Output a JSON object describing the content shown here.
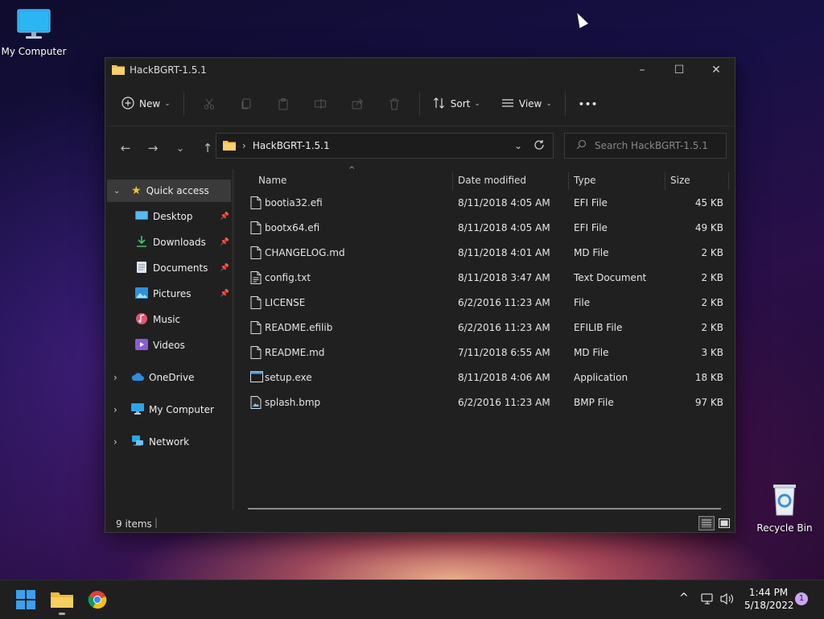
{
  "desktop": {
    "my_computer_label": "My Computer",
    "recycle_bin_label": "Recycle Bin"
  },
  "window": {
    "title": "HackBGRT-1.5.1",
    "controls": {
      "minimize": "–",
      "maximize": "☐",
      "close": "✕"
    }
  },
  "toolbar": {
    "new_label": "New",
    "sort_label": "Sort",
    "view_label": "View",
    "more_label": "•••"
  },
  "address": {
    "path": "HackBGRT-1.5.1",
    "search_placeholder": "Search HackBGRT-1.5.1"
  },
  "sidebar": {
    "quick_access": "Quick access",
    "items": [
      {
        "label": "Desktop",
        "pinned": true
      },
      {
        "label": "Downloads",
        "pinned": true
      },
      {
        "label": "Documents",
        "pinned": true
      },
      {
        "label": "Pictures",
        "pinned": true
      },
      {
        "label": "Music",
        "pinned": false
      },
      {
        "label": "Videos",
        "pinned": false
      }
    ],
    "onedrive": "OneDrive",
    "my_computer": "My Computer",
    "network": "Network"
  },
  "columns": {
    "name": "Name",
    "date": "Date modified",
    "type": "Type",
    "size": "Size"
  },
  "files": [
    {
      "name": "bootia32.efi",
      "date": "8/11/2018 4:05 AM",
      "type": "EFI File",
      "size": "45 KB",
      "icon": "file-icon"
    },
    {
      "name": "bootx64.efi",
      "date": "8/11/2018 4:05 AM",
      "type": "EFI File",
      "size": "49 KB",
      "icon": "file-icon"
    },
    {
      "name": "CHANGELOG.md",
      "date": "8/11/2018 4:01 AM",
      "type": "MD File",
      "size": "2 KB",
      "icon": "file-icon"
    },
    {
      "name": "config.txt",
      "date": "8/11/2018 3:47 AM",
      "type": "Text Document",
      "size": "2 KB",
      "icon": "text-file-icon"
    },
    {
      "name": "LICENSE",
      "date": "6/2/2016 11:23 AM",
      "type": "File",
      "size": "2 KB",
      "icon": "file-icon"
    },
    {
      "name": "README.efilib",
      "date": "6/2/2016 11:23 AM",
      "type": "EFILIB File",
      "size": "2 KB",
      "icon": "file-icon"
    },
    {
      "name": "README.md",
      "date": "7/11/2018 6:55 AM",
      "type": "MD File",
      "size": "3 KB",
      "icon": "file-icon"
    },
    {
      "name": "setup.exe",
      "date": "8/11/2018 4:06 AM",
      "type": "Application",
      "size": "18 KB",
      "icon": "application-icon"
    },
    {
      "name": "splash.bmp",
      "date": "6/2/2016 11:23 AM",
      "type": "BMP File",
      "size": "97 KB",
      "icon": "image-file-icon"
    }
  ],
  "status": {
    "item_count": "9 items"
  },
  "taskbar": {
    "time": "1:44 PM",
    "date": "5/18/2022",
    "notification_count": "1"
  },
  "colors": {
    "accent": "#0078d4",
    "folder": "#f2c14e",
    "window_bg": "#202020"
  }
}
